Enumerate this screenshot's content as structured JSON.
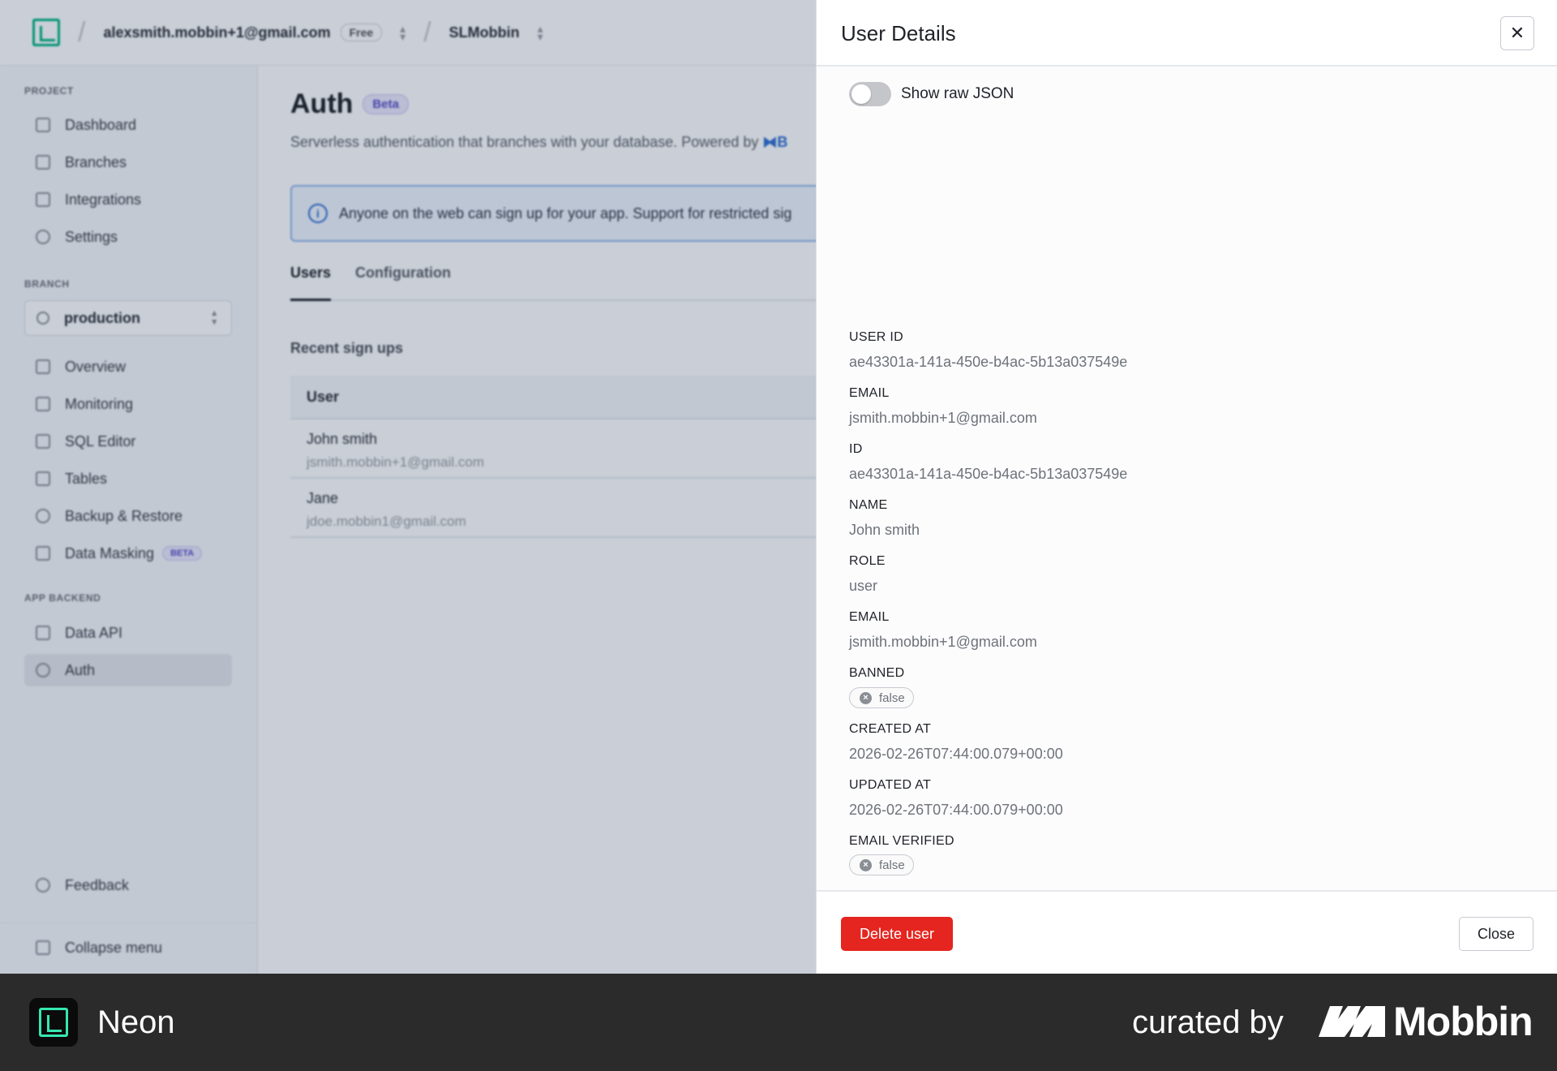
{
  "topbar": {
    "account_email": "alexsmith.mobbin+1@gmail.com",
    "plan_badge": "Free",
    "project_name": "SLMobbin"
  },
  "sidebar": {
    "project_section": "PROJECT",
    "project_items": [
      {
        "label": "Dashboard",
        "icon": "dashboard-icon"
      },
      {
        "label": "Branches",
        "icon": "branches-icon"
      },
      {
        "label": "Integrations",
        "icon": "integrations-icon"
      },
      {
        "label": "Settings",
        "icon": "settings-icon"
      }
    ],
    "branch_section": "BRANCH",
    "branch_selected": "production",
    "branch_items": [
      {
        "label": "Overview",
        "icon": "overview-icon"
      },
      {
        "label": "Monitoring",
        "icon": "monitoring-icon"
      },
      {
        "label": "SQL Editor",
        "icon": "sql-editor-icon"
      },
      {
        "label": "Tables",
        "icon": "tables-icon"
      },
      {
        "label": "Backup & Restore",
        "icon": "backup-icon"
      },
      {
        "label": "Data Masking",
        "icon": "data-masking-icon",
        "badge": "BETA"
      }
    ],
    "backend_section": "APP BACKEND",
    "backend_items": [
      {
        "label": "Data API",
        "icon": "data-api-icon"
      },
      {
        "label": "Auth",
        "icon": "auth-icon",
        "active": true
      }
    ],
    "feedback": "Feedback",
    "collapse": "Collapse menu"
  },
  "main": {
    "title": "Auth",
    "title_badge": "Beta",
    "subtitle": "Serverless authentication that branches with your database. Powered by",
    "subtitle_brand": "B",
    "info": "Anyone on the web can sign up for your app. Support for restricted sig",
    "tabs": [
      "Users",
      "Configuration"
    ],
    "recent_heading": "Recent sign ups",
    "table_header": "User",
    "users": [
      {
        "name": "John smith",
        "email": "jsmith.mobbin+1@gmail.com"
      },
      {
        "name": "Jane",
        "email": "jdoe.mobbin1@gmail.com"
      }
    ]
  },
  "drawer": {
    "title": "User Details",
    "toggle_label": "Show raw JSON",
    "toggle_on": false,
    "fields": [
      {
        "label": "USER ID",
        "value": "ae43301a-141a-450e-b4ac-5b13a037549e"
      },
      {
        "label": "EMAIL",
        "value": "jsmith.mobbin+1@gmail.com"
      },
      {
        "label": "ID",
        "value": "ae43301a-141a-450e-b4ac-5b13a037549e"
      },
      {
        "label": "NAME",
        "value": "John smith"
      },
      {
        "label": "ROLE",
        "value": "user"
      },
      {
        "label": "EMAIL",
        "value": "jsmith.mobbin+1@gmail.com"
      },
      {
        "label": "BANNED",
        "value": "false"
      },
      {
        "label": "CREATED AT",
        "value": "2026-02-26T07:44:00.079+00:00"
      },
      {
        "label": "UPDATED AT",
        "value": "2026-02-26T07:44:00.079+00:00"
      },
      {
        "label": "EMAIL VERIFIED",
        "value": "false"
      }
    ],
    "delete_label": "Delete user",
    "close_label": "Close"
  },
  "banner": {
    "app_name": "Neon",
    "curated_text": "curated by",
    "brand": "Mobbin"
  },
  "colors": {
    "accent_green": "#00b383",
    "danger": "#e5251f",
    "info_blue": "#2f6fd1"
  }
}
